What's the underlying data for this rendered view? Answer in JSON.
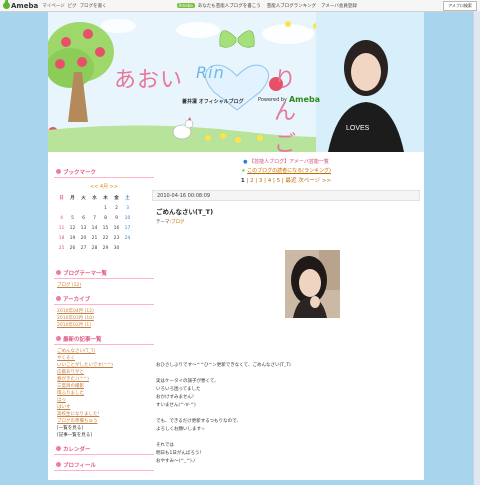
{
  "topbar": {
    "logo": "Ameba",
    "nav": [
      "マイページ",
      "ピグ",
      "ブログを書く"
    ],
    "promo_badge": "Ameba",
    "promo_text": "あなたも芸能人ブログを書こう",
    "promo2": [
      "芸能人ブログランキング",
      "アメーバ会員登録"
    ],
    "search_button": "アメブロ検索"
  },
  "header": {
    "title_left": "あおい",
    "title_center": "Rin",
    "title_right": "りんご",
    "subtitle": "蒼井凜 オフィシャルブログ",
    "powered_by": "Powered by",
    "powered_brand": "Ameba"
  },
  "sidebar": {
    "bookmark": "ブックマーク",
    "calendar_nav": "<< 4月 >>",
    "weekdays": [
      "日",
      "月",
      "火",
      "水",
      "木",
      "金",
      "土"
    ],
    "weeks": [
      [
        "",
        "",
        "",
        "",
        "1",
        "2",
        "3"
      ],
      [
        "4",
        "5",
        "6",
        "7",
        "8",
        "9",
        "10"
      ],
      [
        "11",
        "12",
        "13",
        "14",
        "15",
        "16",
        "17"
      ],
      [
        "18",
        "19",
        "20",
        "21",
        "22",
        "23",
        "24"
      ],
      [
        "25",
        "26",
        "27",
        "28",
        "29",
        "30",
        ""
      ],
      [
        "",
        "",
        "",
        "",
        "",
        "",
        ""
      ]
    ],
    "themes_title": "ブログテーマ一覧",
    "themes": [
      "ブログ (12)"
    ],
    "archive_title": "アーカイブ",
    "archive": [
      "2010年04月 (12)",
      "2010年03月 (10)",
      "2010年02月 (1)"
    ],
    "recent_title": "最新の記事一覧",
    "recent": [
      "ごめんなさい(T_T)",
      "やくそく",
      "いいことがしたいです(^^)",
      "応援ありがと",
      "春がきた♪(^^)",
      "三度目の撮影",
      "雨ふりました",
      "ほっ",
      "はいす",
      "高校生になりました!",
      "ブログの準備ちゅう"
    ],
    "recent_links": [
      "[一覧を見る]",
      "[記事一覧を見る]"
    ],
    "calendar_title": "カレンダー",
    "profile_title": "プロフィール"
  },
  "main": {
    "notice_title": "【芸能人ブログ】アメーバ芸能一覧",
    "notice_sub": "このブログの読者になる(ランキング)",
    "pager": [
      "1",
      "2",
      "3",
      "4",
      "5",
      "最近",
      "次ページ >>"
    ],
    "entry_date": "2010-04-16 00:08:09",
    "entry_title": "ごめんなさい(T_T)",
    "entry_theme_label": "テーマ:",
    "entry_theme": "ブログ",
    "body": [
      "おひさしぶりです〜^^ひ^ン更新できなくて、ごめんなさい(T_T)",
      "",
      "実はケータイの調子が悪くて、",
      "いろいろ困ってました",
      "おかけすみません！",
      "すいません(^-∀-^)",
      "",
      "でも、できるだけ更新するつもりなので、",
      "よろしくお願いします☆",
      "",
      "それでは",
      "明日も1日がんばろう！",
      "おやすみ〜(^_^)ノ"
    ]
  }
}
